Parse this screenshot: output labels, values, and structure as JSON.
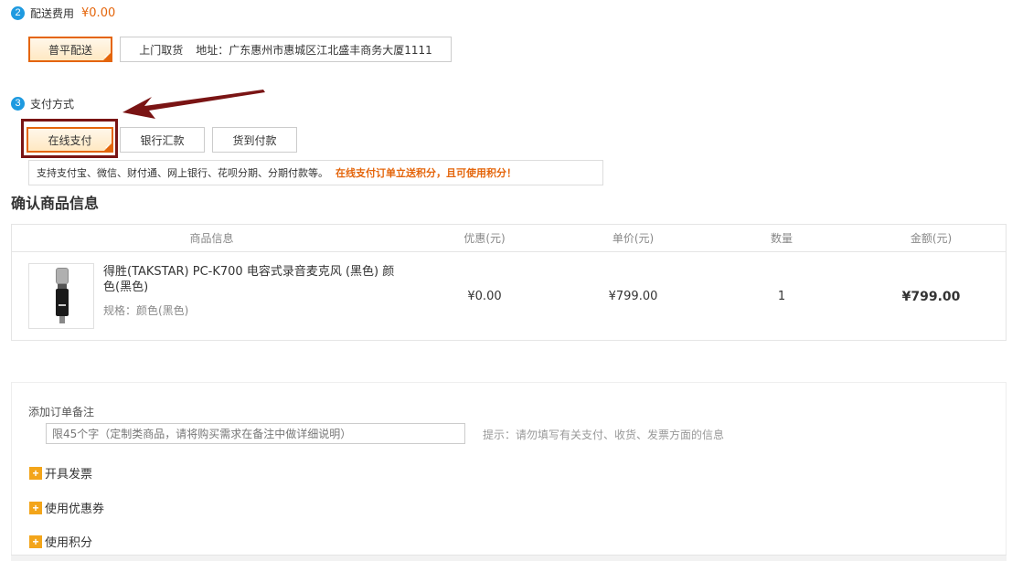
{
  "shipping": {
    "step_number": "2",
    "title": "配送费用",
    "fee": "¥0.00",
    "options": [
      {
        "label": "普平配送",
        "selected": true
      },
      {
        "label": "上门取货",
        "address": "地址：广东惠州市惠城区江北盛丰商务大厦1111",
        "selected": false
      }
    ]
  },
  "payment": {
    "step_number": "3",
    "title": "支付方式",
    "options": [
      {
        "label": "在线支付",
        "selected": true
      },
      {
        "label": "银行汇款",
        "selected": false
      },
      {
        "label": "货到付款",
        "selected": false
      }
    ],
    "hint": "支持支付宝、微信、财付通、网上银行、花呗分期、分期付款等。",
    "hint_highlight": "在线支付订单立送积分，且可使用积分！"
  },
  "confirm": {
    "title": "确认商品信息",
    "headers": [
      "商品信息",
      "优惠(元)",
      "单价(元)",
      "数量",
      "金额(元)"
    ],
    "item": {
      "name": "得胜(TAKSTAR) PC-K700 电容式录音麦克风 (黑色)  颜色(黑色)",
      "spec": "规格：颜色(黑色)",
      "discount": "¥0.00",
      "unit_price": "¥799.00",
      "quantity": "1",
      "amount": "¥799.00"
    }
  },
  "remarks": {
    "label": "添加订单备注",
    "placeholder": "限45个字（定制类商品，请将购买需求在备注中做详细说明）",
    "tip": "提示：请勿填写有关支付、收货、发票方面的信息"
  },
  "expanders": [
    {
      "label": "开具发票"
    },
    {
      "label": "使用优惠券"
    },
    {
      "label": "使用积分"
    }
  ],
  "colors": {
    "accent": "#e4650b",
    "step_badge": "#1e9ae0",
    "annotation": "#7a1414",
    "plus_icon": "#f3a51a"
  }
}
